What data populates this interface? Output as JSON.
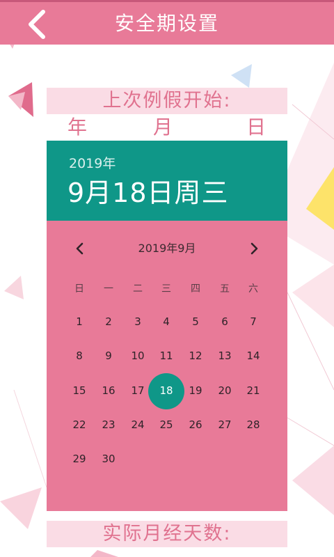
{
  "header": {
    "title": "安全期设置",
    "back_icon": "chevron-left-icon"
  },
  "last_period": {
    "label": "上次例假开始:",
    "year_unit": "年",
    "month_unit": "月",
    "day_unit": "日"
  },
  "date_picker": {
    "header_year": "2019年",
    "header_date": "9月18日周三",
    "month_label": "2019年9月",
    "prev_icon": "chevron-left-icon",
    "next_icon": "chevron-right-icon",
    "weekdays": [
      "日",
      "一",
      "二",
      "三",
      "四",
      "五",
      "六"
    ],
    "first_weekday_index": 0,
    "days": [
      "1",
      "2",
      "3",
      "4",
      "5",
      "6",
      "7",
      "8",
      "9",
      "10",
      "11",
      "12",
      "13",
      "14",
      "15",
      "16",
      "17",
      "18",
      "19",
      "20",
      "21",
      "22",
      "23",
      "24",
      "25",
      "26",
      "27",
      "28",
      "29",
      "30"
    ],
    "selected_day": "18"
  },
  "period_length": {
    "label": "实际月经天数:"
  },
  "colors": {
    "header": "#e87a98",
    "accent": "#0f9788",
    "label_text": "#e0728f"
  }
}
